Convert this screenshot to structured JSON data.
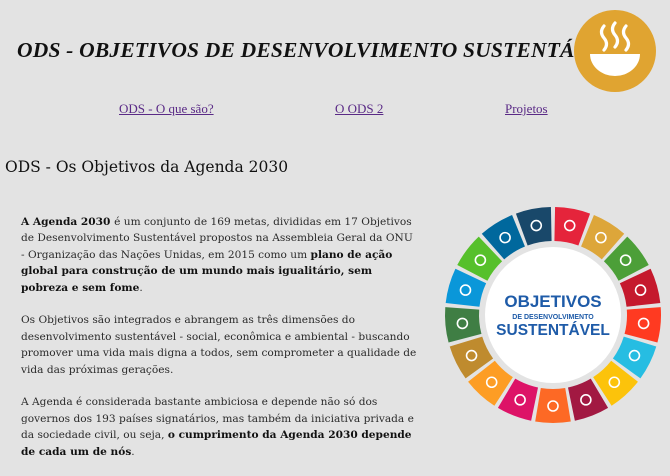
{
  "header": {
    "title": "ODS - OBJETIVOS DE DESENVOLVIMENTO SUSTENTÁVEL",
    "logo_icon": "bowl-icon",
    "logo_color": "#e0a431"
  },
  "nav": {
    "items": [
      {
        "label": "ODS - O que são?"
      },
      {
        "label": "O ODS 2"
      },
      {
        "label": "Projetos"
      }
    ],
    "link_color": "#5a2a86"
  },
  "main": {
    "section_title": "ODS - Os Objetivos da Agenda 2030",
    "p1": {
      "b1": "A Agenda 2030 ",
      "t1": "é um conjunto de 169 metas, divididas em 17 Objetivos de Desenvolvimento Sustentável propostos na Assembleia Geral da ONU - Organização das Nações Unidas, em 2015 como um ",
      "b2": "plano de ação global para construção de um mundo mais igualitário, sem pobreza e sem fome",
      "t2": "."
    },
    "p2": {
      "t1": "Os Objetivos são integrados e abrangem as três dimensões do desenvolvimento sustentável - social, econômica e ambiental - buscando promover uma vida mais digna a todos, sem comprometer a qualidade de vida das próximas gerações."
    },
    "p3": {
      "t1": "A Agenda é considerada bastante ambiciosa e depende não só dos governos dos 193 países signatários, mas também da iniciativa privada e da sociedade civil, ou seja, ",
      "b1": "o cumprimento da Agenda 2030 depende de cada um de nós",
      "t2": "."
    }
  },
  "ods_image": {
    "line1": "OBJETIVOS",
    "line2": "DE DESENVOLVIMENTO",
    "line3": "SUSTENTÁVEL",
    "text_color": "#1e5ba8",
    "segment_colors": [
      "#e5243b",
      "#dda63a",
      "#4c9f38",
      "#c5192d",
      "#ff3a21",
      "#26bde2",
      "#fcc30b",
      "#a21942",
      "#fd6925",
      "#dd1367",
      "#fd9d24",
      "#bf8b2e",
      "#3f7e44",
      "#0a97d9",
      "#56c02b",
      "#00689d",
      "#19486a"
    ]
  }
}
